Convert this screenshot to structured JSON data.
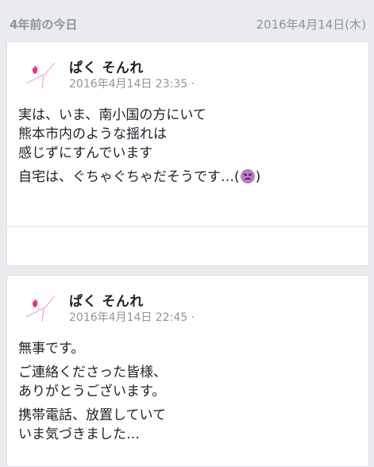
{
  "header": {
    "title": "4年前の今日",
    "date": "2016年4月14日(木)"
  },
  "posts": [
    {
      "author": "ぱく そんれ",
      "timestamp": "2016年4月14日 23:35 ·",
      "paragraphs": [
        [
          "実は、いま、南小国の方にいて",
          "熊本市内のような揺れは",
          "感じずにすんでいます"
        ],
        [
          "自宅は、ぐちゃぐちゃだそうです…(",
          ")"
        ]
      ],
      "emoji": "confounded-face-icon"
    },
    {
      "author": "ぱく そんれ",
      "timestamp": "2016年4月14日 22:45 ·",
      "paragraphs": [
        [
          "無事です。"
        ],
        [
          "ご連絡くださった皆様、",
          "ありがとうございます。"
        ],
        [
          "携帯電話、放置していて",
          "いま気づきました…"
        ]
      ]
    }
  ],
  "colors": {
    "background": "#e9ebee",
    "card": "#ffffff",
    "text": "#1d2129",
    "muted": "#90949c",
    "avatar_pink": "#ee2c8c"
  }
}
